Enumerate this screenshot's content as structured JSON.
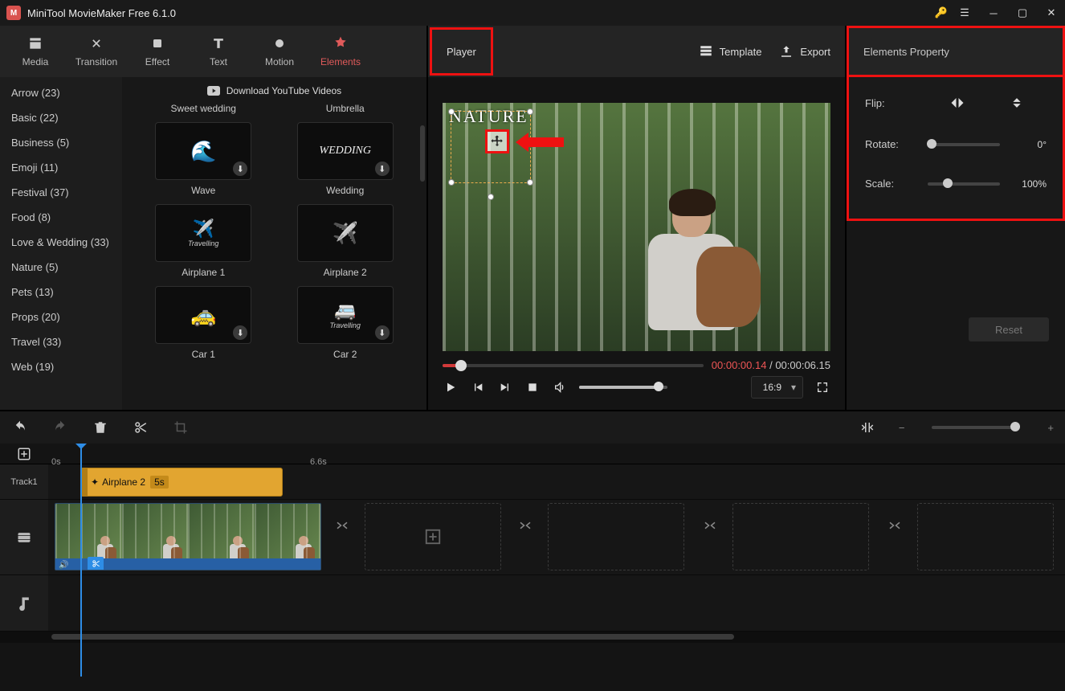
{
  "app": {
    "title": "MiniTool MovieMaker Free 6.1.0"
  },
  "toptabs": {
    "media": "Media",
    "transition": "Transition",
    "effect": "Effect",
    "text": "Text",
    "motion": "Motion",
    "elements": "Elements"
  },
  "categories": [
    "Arrow (23)",
    "Basic (22)",
    "Business (5)",
    "Emoji (11)",
    "Festival (37)",
    "Food (8)",
    "Love & Wedding (33)",
    "Nature (5)",
    "Pets (13)",
    "Props (20)",
    "Travel (33)",
    "Web (19)"
  ],
  "download_row": "Download YouTube Videos",
  "thumbs": {
    "r0c0": "Sweet wedding",
    "r0c1": "Umbrella",
    "r1c0": "Wave",
    "r1c1": "Wedding",
    "r2c0": "Airplane 1",
    "r2c1": "Airplane 2",
    "r3c0": "Car 1",
    "r3c1": "Car 2",
    "wedding_text": "WEDDING",
    "travel1": "Travelling",
    "travel2": "Travelling"
  },
  "player": {
    "tab": "Player",
    "template": "Template",
    "export": "Export",
    "overlay_text": "NATURE",
    "time_current": "00:00:00.14",
    "time_sep": " / ",
    "time_total": "00:00:06.15",
    "aspect": "16:9"
  },
  "props": {
    "title": "Elements Property",
    "flip": "Flip:",
    "rotate": "Rotate:",
    "rotate_val": "0°",
    "scale": "Scale:",
    "scale_val": "100%",
    "reset": "Reset"
  },
  "timeline": {
    "ruler0": "0s",
    "ruler1": "6.6s",
    "track1": "Track1",
    "clip_name": "Airplane 2",
    "clip_dur": "5s"
  }
}
